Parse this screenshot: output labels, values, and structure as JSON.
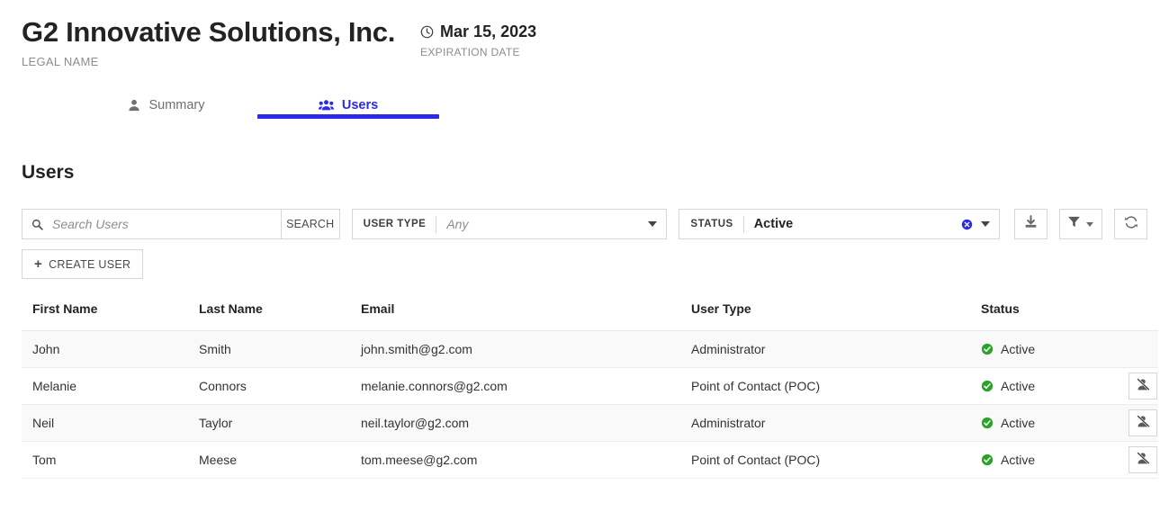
{
  "header": {
    "legal_name": "G2 Innovative Solutions, Inc.",
    "legal_name_label": "LEGAL NAME",
    "expiration_date": "Mar 15, 2023",
    "expiration_label": "EXPIRATION DATE",
    "clock_icon": "clock-icon"
  },
  "tabs": [
    {
      "label": "Summary",
      "icon": "user-icon",
      "active": false
    },
    {
      "label": "Users",
      "icon": "users-icon",
      "active": true
    }
  ],
  "section": {
    "title": "Users"
  },
  "toolbar": {
    "search_placeholder": "Search Users",
    "search_value": "",
    "search_icon": "search-icon",
    "search_button": "SEARCH",
    "user_type_filter": {
      "label": "USER TYPE",
      "value": "Any",
      "is_placeholder": true
    },
    "status_filter": {
      "label": "STATUS",
      "value": "Active",
      "is_placeholder": false,
      "clear_icon": "clear-circle-icon"
    },
    "export_button": {
      "icon": "download-icon"
    },
    "filter_button": {
      "icon": "funnel-icon"
    },
    "refresh_button": {
      "icon": "refresh-icon"
    },
    "create_user_button": "CREATE USER"
  },
  "table": {
    "columns": [
      "First Name",
      "Last Name",
      "Email",
      "User Type",
      "Status",
      ""
    ],
    "rows": [
      {
        "first_name": "John",
        "last_name": "Smith",
        "email": "john.smith@g2.com",
        "user_type": "Administrator",
        "status": "Active",
        "status_icon": "check-circle-icon",
        "has_action": false,
        "action_icon": ""
      },
      {
        "first_name": "Melanie",
        "last_name": "Connors",
        "email": "melanie.connors@g2.com",
        "user_type": "Point of Contact (POC)",
        "status": "Active",
        "status_icon": "check-circle-icon",
        "has_action": true,
        "action_icon": "user-slash-icon"
      },
      {
        "first_name": "Neil",
        "last_name": "Taylor",
        "email": "neil.taylor@g2.com",
        "user_type": "Administrator",
        "status": "Active",
        "status_icon": "check-circle-icon",
        "has_action": true,
        "action_icon": "user-slash-icon"
      },
      {
        "first_name": "Tom",
        "last_name": "Meese",
        "email": "tom.meese@g2.com",
        "user_type": "Point of Contact (POC)",
        "status": "Active",
        "status_icon": "check-circle-icon",
        "has_action": true,
        "action_icon": "user-slash-icon"
      }
    ]
  },
  "colors": {
    "accent_blue": "#2b2ae8",
    "status_green": "#29a329",
    "border": "#d6d6d6",
    "row_alt": "#f9f9f9"
  }
}
